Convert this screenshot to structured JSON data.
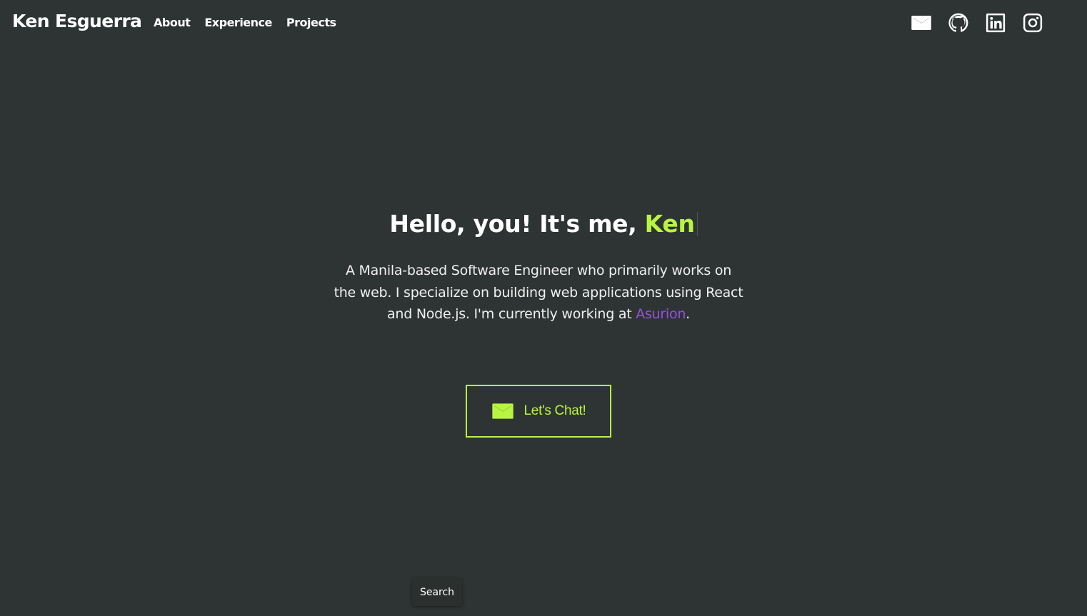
{
  "header": {
    "brand": "Ken Esguerra",
    "nav": [
      {
        "label": "About"
      },
      {
        "label": "Experience"
      },
      {
        "label": "Projects"
      }
    ],
    "socials": [
      {
        "icon": "mail-icon"
      },
      {
        "icon": "github-icon"
      },
      {
        "icon": "linkedin-icon"
      },
      {
        "icon": "instagram-icon"
      }
    ]
  },
  "hero": {
    "greeting": "Hello, you! It's me, ",
    "name": "Ken",
    "description": "A Manila-based Software Engineer who primarily works on the web. I specialize on building web applications using React and Node.js. I'm currently working at ",
    "company": "Asurion",
    "period": "."
  },
  "cta": {
    "label": "Let's Chat!",
    "icon": "mail-icon"
  },
  "tooltip": {
    "label": "Search"
  },
  "colors": {
    "background": "#2e3433",
    "accent": "#b8f542",
    "link": "#9a4ee8"
  }
}
